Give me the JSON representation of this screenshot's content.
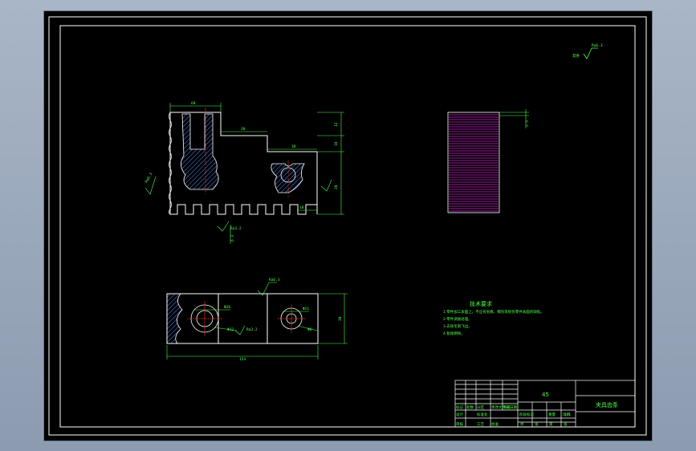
{
  "drawing": {
    "roughness_top_right": "Ra6.3",
    "roughness_top_right_prefix": "其余",
    "front_view": {
      "dim_top": "60",
      "dim_step1": "30",
      "dim_step2": "38",
      "dim_right_1": "12",
      "dim_right_2": "18",
      "dim_right_3": "28",
      "dim_slot": "18",
      "roughness_left": "Ra6.3",
      "roughness_bottom": "Ra3.2",
      "roughness_bottom2": "6.3"
    },
    "side_view": {
      "dim": "2.5"
    },
    "top_view": {
      "roughness": "Ra6.3",
      "dim_hole_left": "Φ26",
      "dim_hole_left2": "Φ12",
      "dim_hole_right": "Φ21",
      "dim_hole_right2": "Φ8",
      "dim_width": "30",
      "dim_length": "154",
      "roughness2": "Ra3.2"
    },
    "tech_req": {
      "title": "技术要求",
      "lines": [
        "1.零件加工表面上，不应有划痕、擦伤等损伤零件表面的缺陷。",
        "2.零件调质处理。",
        "3.去除毛刺飞边。",
        "4.锐角倒钝。"
      ]
    },
    "title_block": {
      "material": "45",
      "part_name": "夹具齿条",
      "labels": [
        "标记",
        "处数",
        "分区",
        "更改文件号",
        "签名",
        "日期"
      ],
      "labels2": [
        "设计",
        "标准化",
        "阶段标记",
        "重量",
        "比例"
      ],
      "labels3": [
        "审核",
        "工艺",
        "批准",
        "共",
        "张",
        "第",
        "张"
      ],
      "scale": "1:1"
    }
  }
}
